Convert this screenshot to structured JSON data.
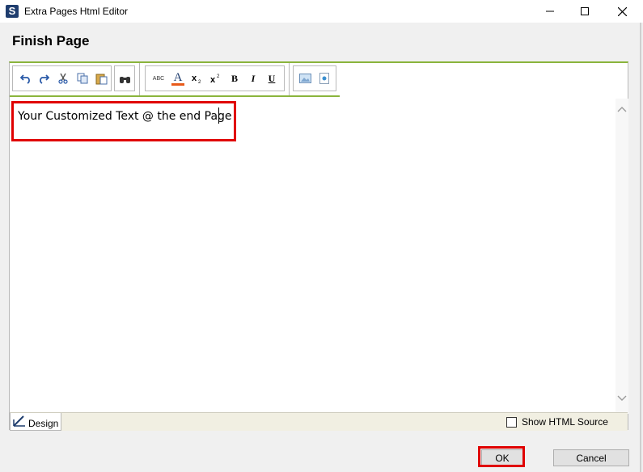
{
  "window": {
    "title": "Extra Pages Html Editor",
    "app_icon_letter": "S"
  },
  "page": {
    "title": "Finish Page"
  },
  "toolbar": {
    "buttons": [
      "undo-icon",
      "redo-icon",
      "cut-icon",
      "copy-icon",
      "paste-icon",
      "find-icon",
      "spellcheck-icon",
      "font-color-icon",
      "subscript-icon",
      "superscript-icon",
      "bold-icon",
      "italic-icon",
      "underline-icon",
      "insert-image-icon",
      "insert-object-icon"
    ],
    "bold_label": "B",
    "italic_label": "I",
    "underline_label": "U",
    "font_color_label": "A",
    "spell_label": "ABC"
  },
  "editor": {
    "content": "Your Customized Text @ the end Page"
  },
  "footer": {
    "design_tab_label": "Design",
    "show_html_label": "Show HTML Source",
    "show_html_checked": false
  },
  "buttons": {
    "ok_label": "OK",
    "cancel_label": "Cancel"
  },
  "colors": {
    "accent_green": "#8ab43c",
    "highlight_red": "#e00000"
  }
}
